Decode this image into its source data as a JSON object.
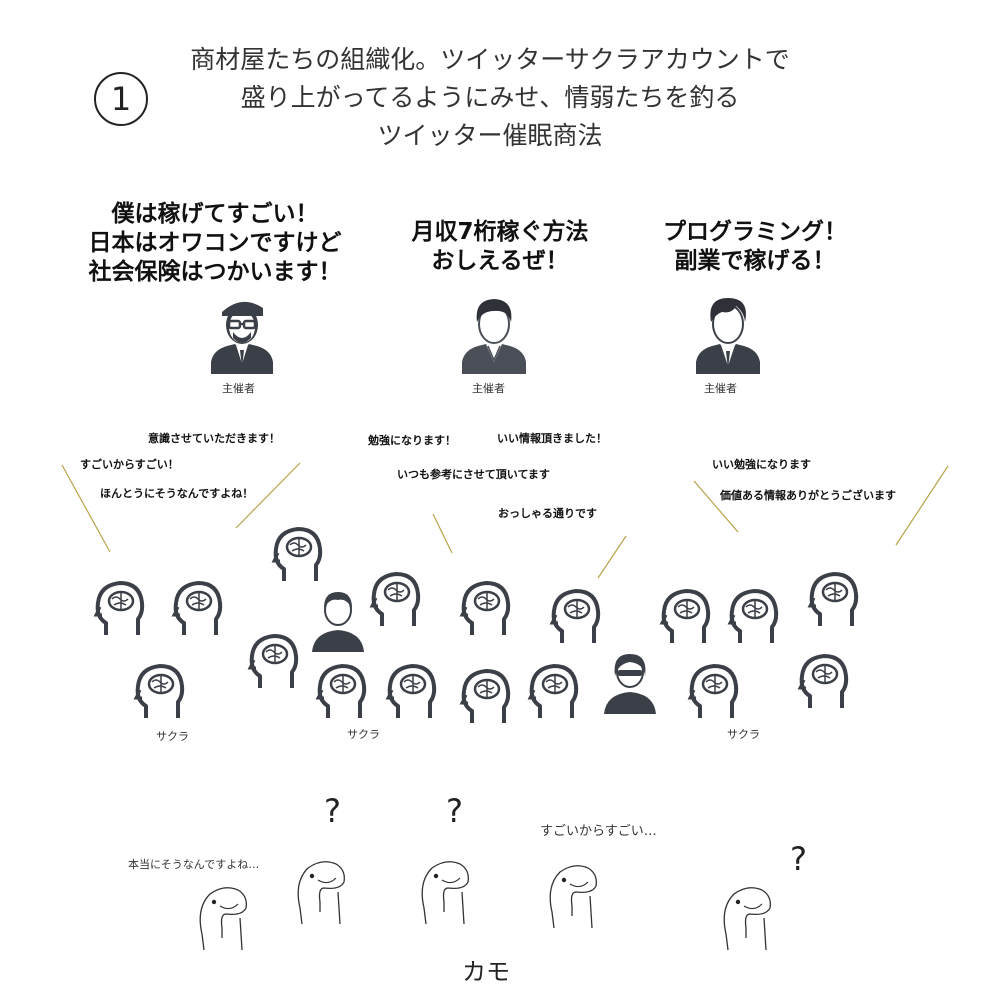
{
  "section_number": "①",
  "title_lines": [
    "商材屋たちの組織化。ツイッターサクラアカウントで",
    "盛り上がってるようにみせ、情弱たちを釣る",
    "ツイッター催眠商法"
  ],
  "organizers": [
    {
      "speech": [
        "僕は稼げてすごい！",
        "日本はオワコンですけど",
        "社会保険はつかいます！"
      ],
      "role": "主催者",
      "icon": "sunglasses-beret-man-icon"
    },
    {
      "speech": [
        "月収7桁稼ぐ方法",
        "おしえるぜ！"
      ],
      "role": "主催者",
      "icon": "casual-man-icon"
    },
    {
      "speech": [
        "プログラミング！",
        "副業で稼げる！"
      ],
      "role": "主催者",
      "icon": "suit-man-icon"
    }
  ],
  "sakura_comments": [
    "意識させていただきます！",
    "すごいからすごい！",
    "ほんとうにそうなんですよね！",
    "勉強になります！",
    "いい情報頂きました！",
    "いつも参考にさせて頂いてます",
    "おっしゃる通りです",
    "いい勉強になります",
    "価値ある情報ありがとうございます"
  ],
  "sakura_labels": [
    "サクラ",
    "サクラ",
    "サクラ"
  ],
  "kamo_comments": [
    "本当にそうなんですよね…",
    "すごいからすごい…"
  ],
  "question_mark": "?",
  "kamo_label": "カモ",
  "colors": {
    "icon": "#3b3f47",
    "line": "#b9a24a",
    "text": "#222222"
  }
}
